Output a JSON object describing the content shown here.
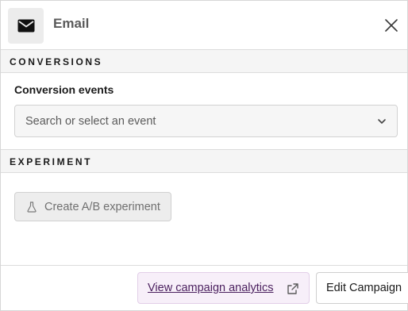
{
  "header": {
    "title": "Email",
    "icon": "envelope-icon",
    "close_icon": "close-icon"
  },
  "conversions": {
    "section_title": "CONVERSIONS",
    "field_label": "Conversion events",
    "select": {
      "placeholder": "Search or select an event",
      "icon": "chevron-down-icon"
    }
  },
  "experiment": {
    "section_title": "EXPERIMENT",
    "button_label": "Create A/B experiment",
    "button_icon": "flask-icon",
    "button_state": "disabled"
  },
  "footer": {
    "analytics_label": "View campaign analytics",
    "analytics_icon": "external-link-icon",
    "edit_label": "Edit Campaign"
  },
  "colors": {
    "accent_text": "#4a1f5e",
    "accent_bg": "#f7eff9",
    "section_bg": "#f5f5f5"
  }
}
